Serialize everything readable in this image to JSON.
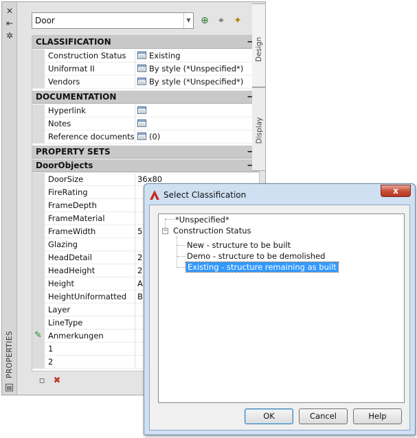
{
  "palette": {
    "title": "PROPERTIES",
    "object_type": "Door",
    "titlebar_icons": [
      "close-icon",
      "auto-hide-icon",
      "settings-icon"
    ],
    "toolbar_icons": [
      "add-selection-icon",
      "pick-point-icon",
      "quick-select-icon"
    ],
    "side_tabs": [
      "Design",
      "Display"
    ],
    "categories": {
      "classification": "CLASSIFICATION",
      "documentation": "DOCUMENTATION",
      "property_sets": "PROPERTY SETS",
      "door_objects": "DoorObjects"
    },
    "classification_rows": [
      {
        "name": "Construction Status",
        "value": "Existing"
      },
      {
        "name": "Uniformat II",
        "value": "By style (*Unspecified*)"
      },
      {
        "name": "Vendors",
        "value": "By style (*Unspecified*)"
      }
    ],
    "documentation_rows": [
      {
        "name": "Hyperlink",
        "value": ""
      },
      {
        "name": "Notes",
        "value": ""
      },
      {
        "name": "Reference documents",
        "value": "(0)"
      }
    ],
    "door_rows": [
      {
        "name": "DoorSize",
        "value": "36x80"
      },
      {
        "name": "FireRating",
        "value": ""
      },
      {
        "name": "FrameDepth",
        "value": ""
      },
      {
        "name": "FrameMaterial",
        "value": ""
      },
      {
        "name": "FrameWidth",
        "value": "5"
      },
      {
        "name": "Glazing",
        "value": ""
      },
      {
        "name": "HeadDetail",
        "value": "2"
      },
      {
        "name": "HeadHeight",
        "value": "2"
      },
      {
        "name": "Height",
        "value": "A"
      },
      {
        "name": "HeightUniformatted",
        "value": "B"
      },
      {
        "name": "Layer",
        "value": ""
      },
      {
        "name": "LineType",
        "value": ""
      },
      {
        "name": "Anmerkungen",
        "value": ""
      },
      {
        "name": "1",
        "value": ""
      },
      {
        "name": "2",
        "value": ""
      }
    ],
    "bottom_icons": [
      "property-set-data-icon",
      "delete-property-set-icon"
    ]
  },
  "dialog": {
    "title": "Select Classification",
    "close_label": "x",
    "tree": [
      {
        "label": "*Unspecified*"
      },
      {
        "label": "Construction Status"
      },
      {
        "label": "New - structure to be built"
      },
      {
        "label": "Demo - structure to be demolished"
      },
      {
        "label": "Existing - structure remaining as built"
      }
    ],
    "buttons": {
      "ok": "OK",
      "cancel": "Cancel",
      "help": "Help"
    }
  }
}
